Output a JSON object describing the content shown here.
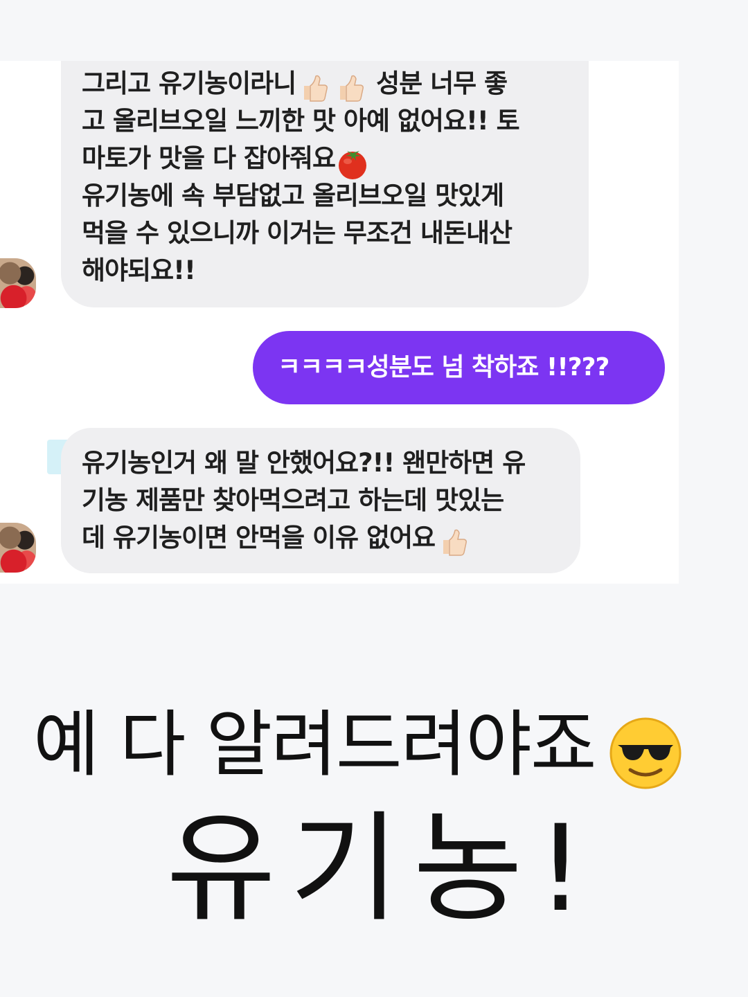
{
  "messages": [
    {
      "direction": "incoming",
      "lines": [
        "그리고 유기농이라니",
        " 성분 너무 좋",
        "고 올리브오일 느끼한 맛 아예 없어요!! 토",
        "마토가 맛을 다 잡아줘요",
        "유기농에 속 부담없고 올리브오일 맛있게",
        "먹을 수 있으니까  이거는 무조건 내돈내산",
        "해야되요!!"
      ]
    },
    {
      "direction": "outgoing",
      "text": "ㅋㅋㅋㅋ성분도 넘 착하죠 !!???"
    },
    {
      "direction": "incoming",
      "lines": [
        "유기농인거 왜 말 안했어요?!! 왠만하면 유",
        "기농 제품만 찾아먹으려고 하는데 맛있는",
        "데 유기농이면 안먹을 이유 없어요"
      ]
    }
  ],
  "caption": {
    "line1": "예 다 알려드려야죠",
    "line2": "유기농!"
  },
  "colors": {
    "incoming_bubble": "#efeff1",
    "outgoing_bubble": "#7c35f2",
    "highlight": "#c7ecf6"
  },
  "icons": [
    "thumbs-up-icon",
    "tomato-icon",
    "sunglasses-face-icon",
    "avatar"
  ]
}
